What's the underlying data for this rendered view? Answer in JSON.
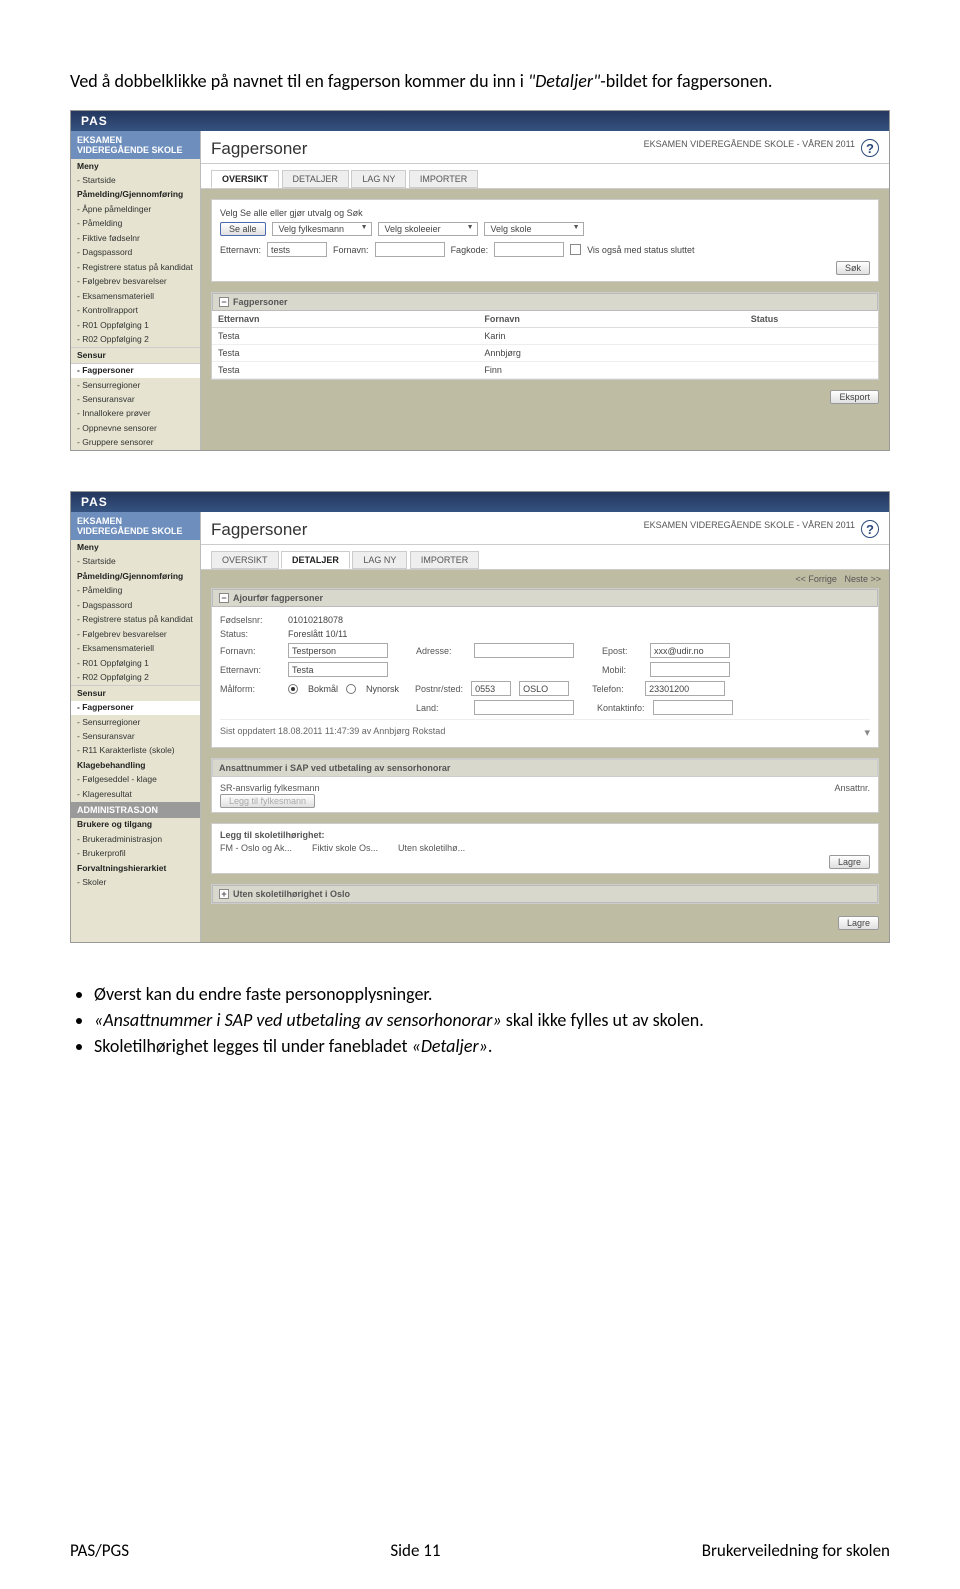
{
  "intro": {
    "before": "Ved å dobbelklikke på navnet til en fagperson kommer du inn i ",
    "ital": "\"Detaljer\"",
    "after": "-bildet for fagpersonen."
  },
  "pas_title": "PAS",
  "exam_heading": "EKSAMEN VIDEREGÅENDE SKOLE - VÅREN 2011",
  "help": "?",
  "shot1": {
    "sidebar_blue": "EKSAMEN VIDEREGÅENDE SKOLE",
    "menu_label": "Meny",
    "items": [
      "Startside",
      "Påmelding/Gjennomføring",
      "Åpne påmeldinger",
      "Påmelding",
      "Fiktive fødselnr",
      "Dagspassord",
      "Registrere status på kandidat",
      "Følgebrev besvarelser",
      "Eksamensmateriell",
      "Kontrollrapport",
      "R01 Oppfølging 1",
      "R02 Oppfølging 2"
    ],
    "sensor": "Sensur",
    "fagpersoner": "Fagpersoner",
    "sensor_items": [
      "Sensurregioner",
      "Sensuransvar",
      "Innallokere prøver",
      "Oppnevne sensorer",
      "Gruppere sensorer"
    ],
    "page_title": "Fagpersoner",
    "tabs": [
      "OVERSIKT",
      "DETALJER",
      "LAG NY",
      "IMPORTER"
    ],
    "active_tab": 0,
    "velg_line": "Velg Se alle eller gjør utvalg og Søk",
    "se_alle": "Se alle",
    "velg_fylkesmann": "Velg fylkesmann",
    "velg_skoleeier": "Velg skoleeier",
    "velg_skole": "Velg skole",
    "etternavn": "Etternavn:",
    "etternavn_val": "tests",
    "fornavn": "Fornavn:",
    "fagkode": "Fagkode:",
    "vis_ogsa": "Vis også med status sluttet",
    "sok": "Søk",
    "grid_title": "Fagpersoner",
    "col_etternavn": "Etternavn",
    "col_fornavn": "Fornavn",
    "col_status": "Status",
    "rows": [
      {
        "e": "Testa",
        "f": "Karin",
        "s": ""
      },
      {
        "e": "Testa",
        "f": "Annbjørg",
        "s": ""
      },
      {
        "e": "Testa",
        "f": "Finn",
        "s": ""
      }
    ],
    "eksport": "Eksport"
  },
  "shot2": {
    "sidebar_blue": "EKSAMEN VIDEREGÅENDE SKOLE",
    "menu_label": "Meny",
    "items": [
      "Startside",
      "Påmelding/Gjennomføring",
      "Påmelding",
      "Dagspassord",
      "Registrere status på kandidat",
      "Følgebrev besvarelser",
      "Eksamensmateriell",
      "R01 Oppfølging 1",
      "R02 Oppfølging 2"
    ],
    "sensor": "Sensur",
    "fagpersoner": "Fagpersoner",
    "sensor_items": [
      "Sensurregioner",
      "Sensuransvar",
      "R11 Karakterliste (skole)"
    ],
    "klage_label": "Klagebehandling",
    "klage_items": [
      "Følgeseddel - klage",
      "Klageresultat"
    ],
    "admin_label": "ADMINISTRASJON",
    "admin_b": "Brukere og tilgang",
    "admin_items": [
      "Brukeradministrasjon",
      "Brukerprofil"
    ],
    "forvalt_label": "Forvaltningshierarkiet",
    "forvalt_items": [
      "Skoler"
    ],
    "page_title": "Fagpersoner",
    "tabs": [
      "OVERSIKT",
      "DETALJER",
      "LAG NY",
      "IMPORTER"
    ],
    "active_tab": 1,
    "nav_prev": "<< Forrige",
    "nav_next": "Neste >>",
    "ajourfor": "Ajourfør fagpersoner",
    "fodselsnr": "Fødselsnr:",
    "fodselsnr_val": "01010218078",
    "status": "Status:",
    "status_val": "Foreslått 10/11",
    "fornavn": "Fornavn:",
    "fornavn_val": "Testperson",
    "etternavn": "Etternavn:",
    "etternavn_val": "Testa",
    "malform": "Målform:",
    "bokmal": "Bokmål",
    "nynorsk": "Nynorsk",
    "adresse": "Adresse:",
    "postnr": "Postnr/sted:",
    "postnr_val": "0553",
    "poststed_val": "OSLO",
    "land": "Land:",
    "epost": "Epost:",
    "epost_val": "xxx@udir.no",
    "mobil": "Mobil:",
    "telefon": "Telefon:",
    "telefon_val": "23301200",
    "kontaktinfo": "Kontaktinfo:",
    "sist_oppdatert": "Sist oppdatert 18.08.2011 11:47:39 av Annbjørg Rokstad",
    "ansatt_header": "Ansattnummer i SAP ved utbetaling av sensorhonorar",
    "sr_ansvarlig": "SR-ansvarlig fylkesmann",
    "ansattnr": "Ansattnr.",
    "legg_til_fm": "Legg til fylkesmann",
    "legg_til_sk": "Legg til skoletilhørighet:",
    "fm_oslo": "FM - Oslo og Ak...",
    "fiktiv": "Fiktiv skole Os...",
    "uten_skole": "Uten skoletilhø...",
    "uten_skole_oslo": "Uten skoletilhørighet i Oslo",
    "lagre": "Lagre"
  },
  "bullets": [
    {
      "text": "Øverst kan du endre faste personopplysninger."
    },
    {
      "ital": "«Ansattnummer i SAP ved utbetaling av sensorhonorar»",
      "after": " skal ikke fylles ut av skolen."
    },
    {
      "before": "Skoletilhørighet legges til under fanebladet ",
      "ital": "«Detaljer»",
      "after": "."
    }
  ],
  "footer": {
    "left": "PAS/PGS",
    "center": "Side 11",
    "right": "Brukerveiledning for skolen"
  }
}
